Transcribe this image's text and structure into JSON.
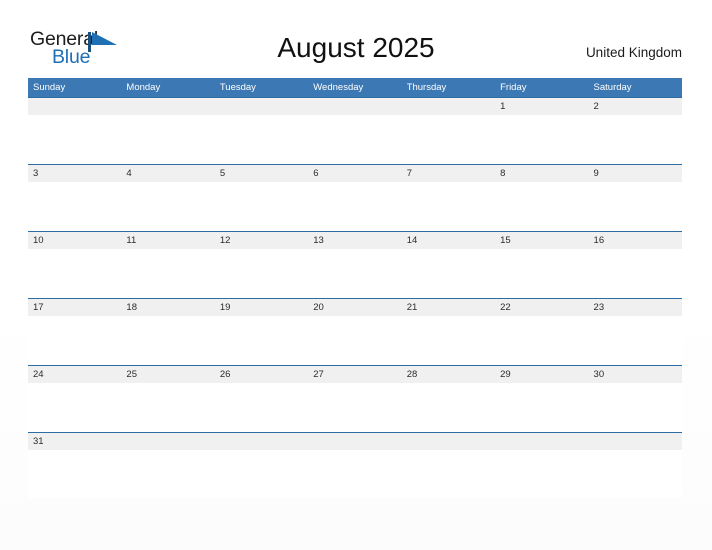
{
  "brand": {
    "name_part1": "General",
    "name_part2": "Blue",
    "mark_icon": "flag-triangle-icon",
    "color_dark": "#1d1d1b",
    "color_blue": "#1f6fb5"
  },
  "header": {
    "title": "August 2025",
    "month": "August",
    "year": "2025",
    "country": "United Kingdom"
  },
  "theme": {
    "header_bar": "#3c78b4",
    "row_border": "#2e6da4",
    "date_strip": "#f0f0f0",
    "page_bg": "#ffffff",
    "text": "#1a1a1a"
  },
  "calendar": {
    "weekdays": [
      "Sunday",
      "Monday",
      "Tuesday",
      "Wednesday",
      "Thursday",
      "Friday",
      "Saturday"
    ],
    "weeks": [
      {
        "days": [
          "",
          "",
          "",
          "",
          "",
          "1",
          "2"
        ]
      },
      {
        "days": [
          "3",
          "4",
          "5",
          "6",
          "7",
          "8",
          "9"
        ]
      },
      {
        "days": [
          "10",
          "11",
          "12",
          "13",
          "14",
          "15",
          "16"
        ]
      },
      {
        "days": [
          "17",
          "18",
          "19",
          "20",
          "21",
          "22",
          "23"
        ]
      },
      {
        "days": [
          "24",
          "25",
          "26",
          "27",
          "28",
          "29",
          "30"
        ]
      },
      {
        "days": [
          "31",
          "",
          "",
          "",
          "",
          "",
          ""
        ]
      }
    ]
  }
}
